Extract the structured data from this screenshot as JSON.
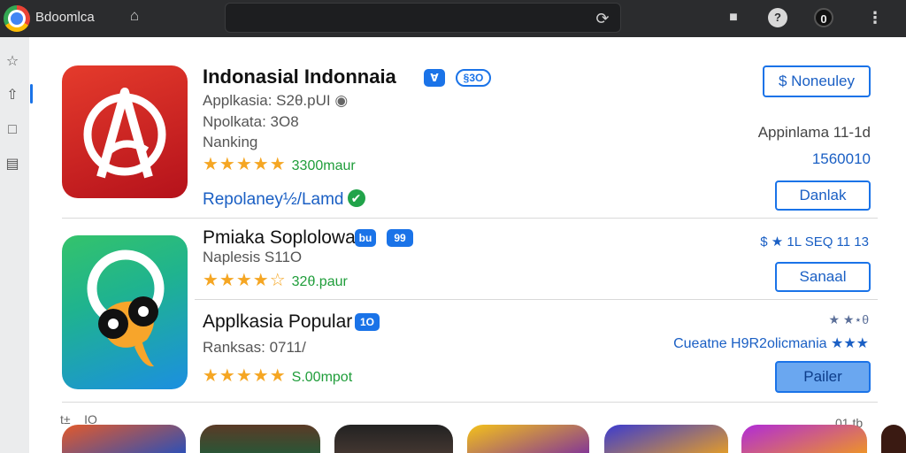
{
  "browser": {
    "title": "Bdoomlca",
    "icons": {
      "logo": "browser-logo-icon",
      "home": "home-icon",
      "reload": "reload-icon",
      "extension": "extension-icon",
      "help": "help-icon",
      "account": "account-icon",
      "menu": "kebab-menu-icon"
    }
  },
  "sidebar": {
    "items": [
      {
        "icon": "star-icon"
      },
      {
        "icon": "thumbs-up-icon"
      },
      {
        "icon": "clipboard-icon"
      },
      {
        "icon": "chat-icon"
      }
    ]
  },
  "apps": [
    {
      "title": "Indonasial Indonnaia",
      "badge": "Ɐ",
      "badge_outline": "§3O",
      "line1": "Applkasia: S2θ.pUI",
      "line2": "Npolkata: 3O8",
      "line3": "Nanking",
      "stars": "★★★★★",
      "downloads": "3300maur",
      "link": "Repolaney½/Lamd",
      "link_check": "✔",
      "button_top": "$ Noneuley",
      "meta1": "Appinlama 11-1d",
      "meta2": "1560010",
      "button": "Danlak"
    },
    {
      "title": "Pmiaka Soplolowar",
      "badge": "bu",
      "badge2": "99",
      "line1": "Naplesis S11O",
      "stars": "★★★★☆",
      "downloads": "32θ.paur",
      "meta1": "$ ★ 1L SEQ 11 13",
      "button": "Sanaal"
    },
    {
      "title": "Applkasia Popular",
      "badge": "1O",
      "line1": "Ranksas: 0711/",
      "stars": "★★★★★",
      "downloads": "S.00mpot",
      "meta_small": "★ ★⋆θ",
      "meta1": "Cueatne H9R2olicmania ★★★",
      "button": "Pailer"
    }
  ],
  "thumbnail_row_labels": {
    "left": "t± _ IO",
    "right": "01 tb"
  },
  "colors": {
    "accent": "#1a73e8",
    "star": "#f5a623",
    "downloads": "#1f9d3a",
    "topbar": "#2b2c2e"
  }
}
